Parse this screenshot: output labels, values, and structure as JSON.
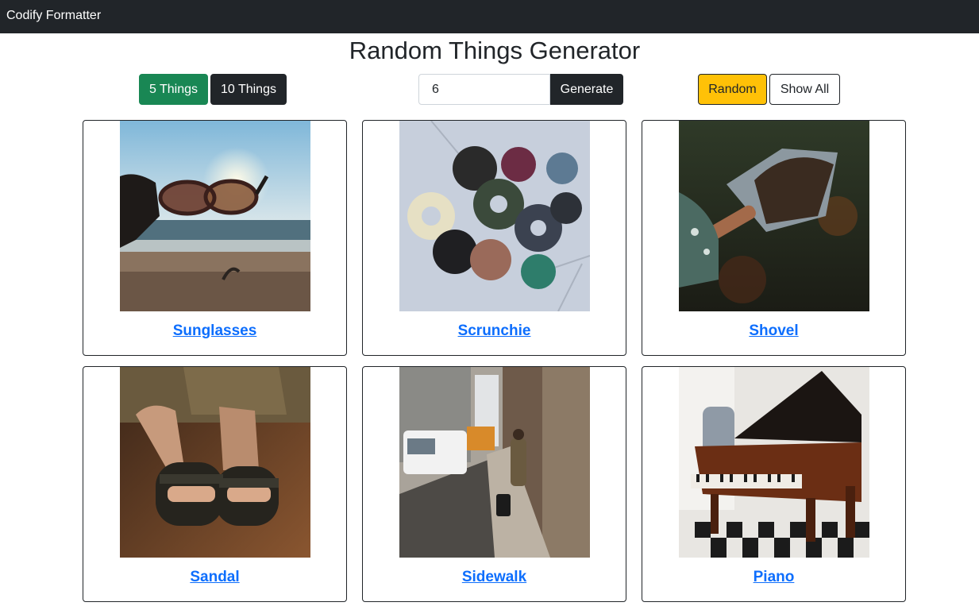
{
  "navbar": {
    "brand": "Codify Formatter"
  },
  "title": "Random Things Generator",
  "controls": {
    "five_label": "5 Things",
    "ten_label": "10 Things",
    "count_value": "6",
    "generate_label": "Generate",
    "random_label": "Random",
    "show_all_label": "Show All"
  },
  "items": [
    {
      "name": "Sunglasses"
    },
    {
      "name": "Scrunchie"
    },
    {
      "name": "Shovel"
    },
    {
      "name": "Sandal"
    },
    {
      "name": "Sidewalk"
    },
    {
      "name": "Piano"
    }
  ],
  "colors": {
    "navbar": "#212529",
    "success": "#198754",
    "dark": "#212529",
    "warning": "#ffc107",
    "link": "#0d6efd"
  }
}
